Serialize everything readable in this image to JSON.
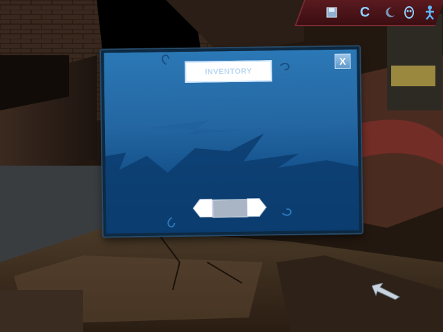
{
  "window": {
    "title": "INVENTORY",
    "close_label": "X"
  },
  "toolbar": {
    "icons": [
      "disk-icon",
      "c-icon",
      "moon-icon",
      "mask-icon",
      "person-icon"
    ],
    "c_label": "C"
  },
  "colors": {
    "panel_top": "#2b78b6",
    "panel_bottom": "#0c4177",
    "toolbar_bg": "#5a1a1f",
    "accent": "#8fd0ff"
  }
}
